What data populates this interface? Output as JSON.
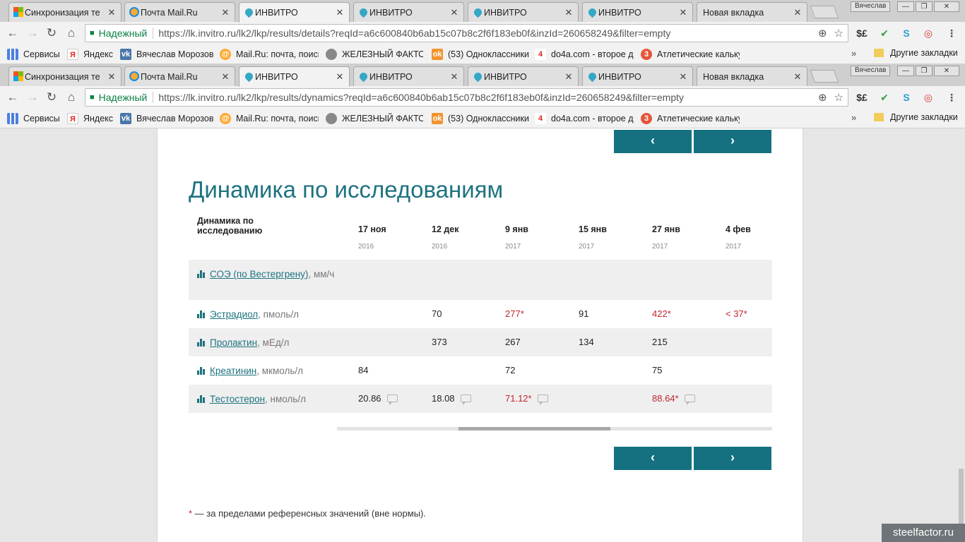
{
  "windows": [
    {
      "tabs": [
        {
          "title": "Синхронизация те",
          "icon": "microsoft-icon"
        },
        {
          "title": "Почта Mail.Ru",
          "icon": "mailru-icon"
        },
        {
          "title": "ИНВИТРО",
          "icon": "invitro-icon"
        },
        {
          "title": "ИНВИТРО",
          "icon": "invitro-icon"
        },
        {
          "title": "ИНВИТРО",
          "icon": "invitro-icon"
        },
        {
          "title": "ИНВИТРО",
          "icon": "invitro-icon"
        },
        {
          "title": "Новая вкладка",
          "icon": ""
        }
      ],
      "profile": "Вячеслав",
      "secure_label": "Надежный",
      "url": "https://lk.invitro.ru/lk2/lkp/results/details?reqId=a6c600840b6ab15c07b8c2f6f183eb0f&inzId=260658249&filter=empty",
      "bookmarks": [
        "Сервисы",
        "Яндекс",
        "Вячеслав Морозов",
        "Mail.Ru: почта, поиск",
        "ЖЕЛЕЗНЫЙ ФАКТОР",
        "(53) Одноклассники",
        "do4a.com - второе д",
        "Атлетические кальку"
      ],
      "other_bookmarks": "Другие закладки"
    },
    {
      "tabs": [
        {
          "title": "Синхронизация те",
          "icon": "microsoft-icon"
        },
        {
          "title": "Почта Mail.Ru",
          "icon": "mailru-icon"
        },
        {
          "title": "ИНВИТРО",
          "icon": "invitro-icon"
        },
        {
          "title": "ИНВИТРО",
          "icon": "invitro-icon"
        },
        {
          "title": "ИНВИТРО",
          "icon": "invitro-icon"
        },
        {
          "title": "ИНВИТРО",
          "icon": "invitro-icon"
        },
        {
          "title": "Новая вкладка",
          "icon": ""
        }
      ],
      "profile": "Вячеслав",
      "secure_label": "Надежный",
      "url": "https://lk.invitro.ru/lk2/lkp/results/dynamics?reqId=a6c600840b6ab15c07b8c2f6f183eb0f&inzId=260658249&filter=empty",
      "bookmarks": [
        "Сервисы",
        "Яндекс",
        "Вячеслав Морозов",
        "Mail.Ru: почта, поиск",
        "ЖЕЛЕЗНЫЙ ФАКТОР",
        "(53) Одноклассники",
        "do4a.com - второе д",
        "Атлетические кальку"
      ],
      "other_bookmarks": "Другие закладки"
    }
  ],
  "page": {
    "prev_label": "‹",
    "next_label": "›",
    "title": "Динамика по исследованиям",
    "table": {
      "header_label": "Динамика по исследованию",
      "dates": [
        {
          "day": "17 ноя",
          "year": "2016"
        },
        {
          "day": "12 дек",
          "year": "2016"
        },
        {
          "day": "9 янв",
          "year": "2017"
        },
        {
          "day": "15 янв",
          "year": "2017"
        },
        {
          "day": "27 янв",
          "year": "2017"
        },
        {
          "day": "4 фев",
          "year": "2017"
        }
      ],
      "rows": [
        {
          "name": "СОЭ (по Вестергрену)",
          "unit": ", мм/ч",
          "values": [
            "",
            "",
            "",
            "",
            "",
            ""
          ],
          "out": [
            false,
            false,
            false,
            false,
            false,
            false
          ],
          "comment": [
            false,
            false,
            false,
            false,
            false,
            false
          ]
        },
        {
          "name": "Эстрадиол",
          "unit": ", пмоль/л",
          "values": [
            "",
            "70",
            "277*",
            "91",
            "422*",
            "< 37*"
          ],
          "out": [
            false,
            false,
            true,
            false,
            true,
            true
          ],
          "comment": [
            false,
            false,
            false,
            false,
            false,
            false
          ]
        },
        {
          "name": "Пролактин",
          "unit": ", мЕд/л",
          "values": [
            "",
            "373",
            "267",
            "134",
            "215",
            ""
          ],
          "out": [
            false,
            false,
            false,
            false,
            false,
            false
          ],
          "comment": [
            false,
            false,
            false,
            false,
            false,
            false
          ]
        },
        {
          "name": "Креатинин",
          "unit": ", мкмоль/л",
          "values": [
            "84",
            "",
            "72",
            "",
            "75",
            ""
          ],
          "out": [
            false,
            false,
            false,
            false,
            false,
            false
          ],
          "comment": [
            false,
            false,
            false,
            false,
            false,
            false
          ]
        },
        {
          "name": "Тестостерон",
          "unit": ", нмоль/л",
          "values": [
            "20.86",
            "18.08",
            "71.12*",
            "",
            "88.64*",
            ""
          ],
          "out": [
            false,
            false,
            true,
            false,
            true,
            false
          ],
          "comment": [
            true,
            true,
            true,
            false,
            true,
            false
          ]
        }
      ]
    },
    "footnote_mark": "*",
    "footnote_text": " — за пределами референсных значений (вне нормы).",
    "accent_color": "#15707f",
    "out_of_range_color": "#c0272d"
  },
  "watermark": "steelfactor.ru"
}
